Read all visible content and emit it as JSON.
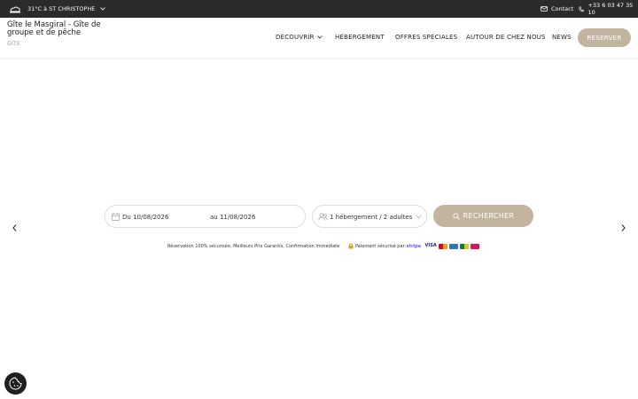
{
  "topbar": {
    "weather": "31°C à ST CHRISTOPHE",
    "contact": "Contact",
    "phone": "+33 6 03 47 35 10"
  },
  "brand": {
    "name": "Gîte le Masgiral - Gîte de groupe et de pêche",
    "type": "GÎTE"
  },
  "nav": {
    "items": [
      {
        "label": "DÉCOUVRIR"
      },
      {
        "label": "HÉBERGEMENT"
      },
      {
        "label": "OFFRES SPÉCIALES"
      },
      {
        "label": "AUTOUR DE CHEZ NOUS"
      },
      {
        "label": "NEWS"
      }
    ],
    "reserve": "RÉSERVER"
  },
  "booking": {
    "date_from": "Du 10/08/2026",
    "date_to": "au 11/08/2026",
    "guests": "1 hébergement / 2 adultes",
    "search": "RECHERCHER"
  },
  "assurance": "Réservation 100% sécurisée, Meilleurs Prix Garantis, Confirmation Immédiate",
  "payment": {
    "label": "Paiement sécurisé par",
    "provider": "stripe",
    "cards": [
      "VISA"
    ]
  },
  "colors": {
    "topbar": "#2b2b2b",
    "accent": "#c2b49f",
    "text": "#2b2b2b"
  }
}
